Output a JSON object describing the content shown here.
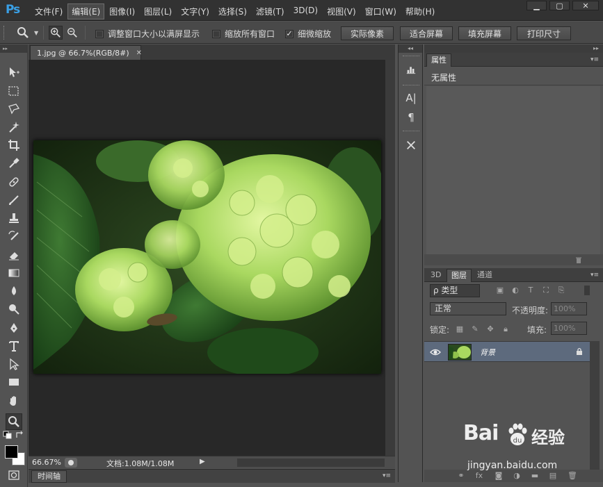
{
  "app": {
    "logo": "Ps"
  },
  "menu": [
    {
      "label": "文件(F)"
    },
    {
      "label": "编辑(E)",
      "active": true
    },
    {
      "label": "图像(I)"
    },
    {
      "label": "图层(L)"
    },
    {
      "label": "文字(Y)"
    },
    {
      "label": "选择(S)"
    },
    {
      "label": "滤镜(T)"
    },
    {
      "label": "3D(D)"
    },
    {
      "label": "视图(V)"
    },
    {
      "label": "窗口(W)"
    },
    {
      "label": "帮助(H)"
    }
  ],
  "window_controls": {
    "minimize": "▁",
    "restore": "▢",
    "close": "✕"
  },
  "options": {
    "resize_windows": "调整窗口大小以满屏显示",
    "zoom_all": "缩放所有窗口",
    "scrubby_zoom": "细微缩放",
    "resize_checked": false,
    "zoom_all_checked": false,
    "scrubby_checked": true,
    "actual_pixels": "实际像素",
    "fit_screen": "适合屏幕",
    "fill_screen": "填充屏幕",
    "print_size": "打印尺寸"
  },
  "document": {
    "tab_title": "1.jpg @ 66.7%(RGB/8#)",
    "tab_close": "✕",
    "zoom": "66.67%",
    "info": "文档:1.08M/1.08M"
  },
  "timeline": {
    "label": "时间轴"
  },
  "properties": {
    "tab": "属性",
    "content": "无属性"
  },
  "layers_panel": {
    "tabs": [
      {
        "label": "3D"
      },
      {
        "label": "图层",
        "active": true
      },
      {
        "label": "通道"
      }
    ],
    "filter_kind": "ρ 类型",
    "blend_mode": "正常",
    "opacity_label": "不透明度:",
    "opacity_value": "100%",
    "lock_label": "锁定:",
    "fill_label": "填充:",
    "fill_value": "100%",
    "layers": [
      {
        "name": "背景"
      }
    ]
  },
  "watermark": {
    "brand": "Bai",
    "suffix": "经验",
    "url": "jingyan.baidu.com"
  },
  "colors": {
    "accent_blue": "#3aa0e6",
    "selected_layer": "#5d6a7d",
    "panel_bg": "#535353",
    "canvas_bg": "#282828"
  }
}
